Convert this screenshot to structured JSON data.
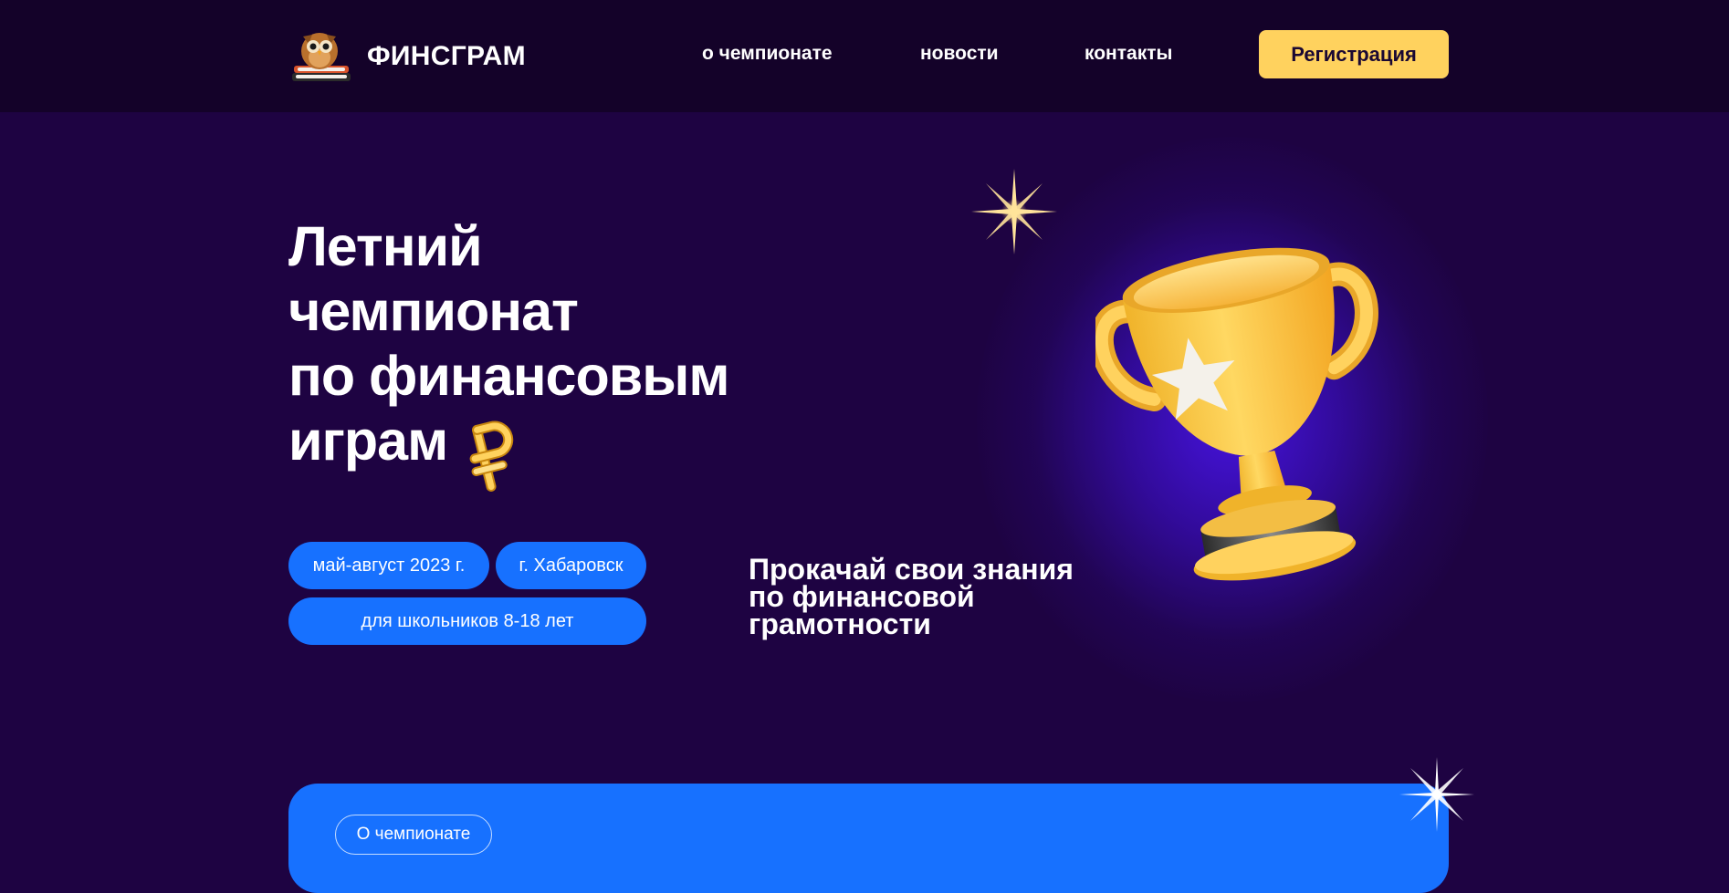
{
  "header": {
    "brand": "ФИНСГРАМ",
    "nav": [
      "о чемпионате",
      "новости",
      "контакты"
    ],
    "register_label": "Регистрация"
  },
  "hero": {
    "title_lines": [
      "Летний",
      "чемпионат",
      "по финансовым",
      "играм"
    ],
    "tags": {
      "dates": "май-август 2023 г.",
      "city": "г. Хабаровск",
      "audience": "для школьников 8-18 лет"
    },
    "subtitle_lines": [
      "Прокачай свои знания",
      "по финансовой",
      "грамотности"
    ]
  },
  "about": {
    "label": "О чемпионате"
  },
  "colors": {
    "background": "#1e0342",
    "header": "#140229",
    "accent_blue": "#1771ff",
    "accent_yellow": "#ffd25e"
  },
  "icons": [
    "owl-logo-icon",
    "ruble-icon",
    "trophy-icon",
    "sparkle-icon"
  ]
}
